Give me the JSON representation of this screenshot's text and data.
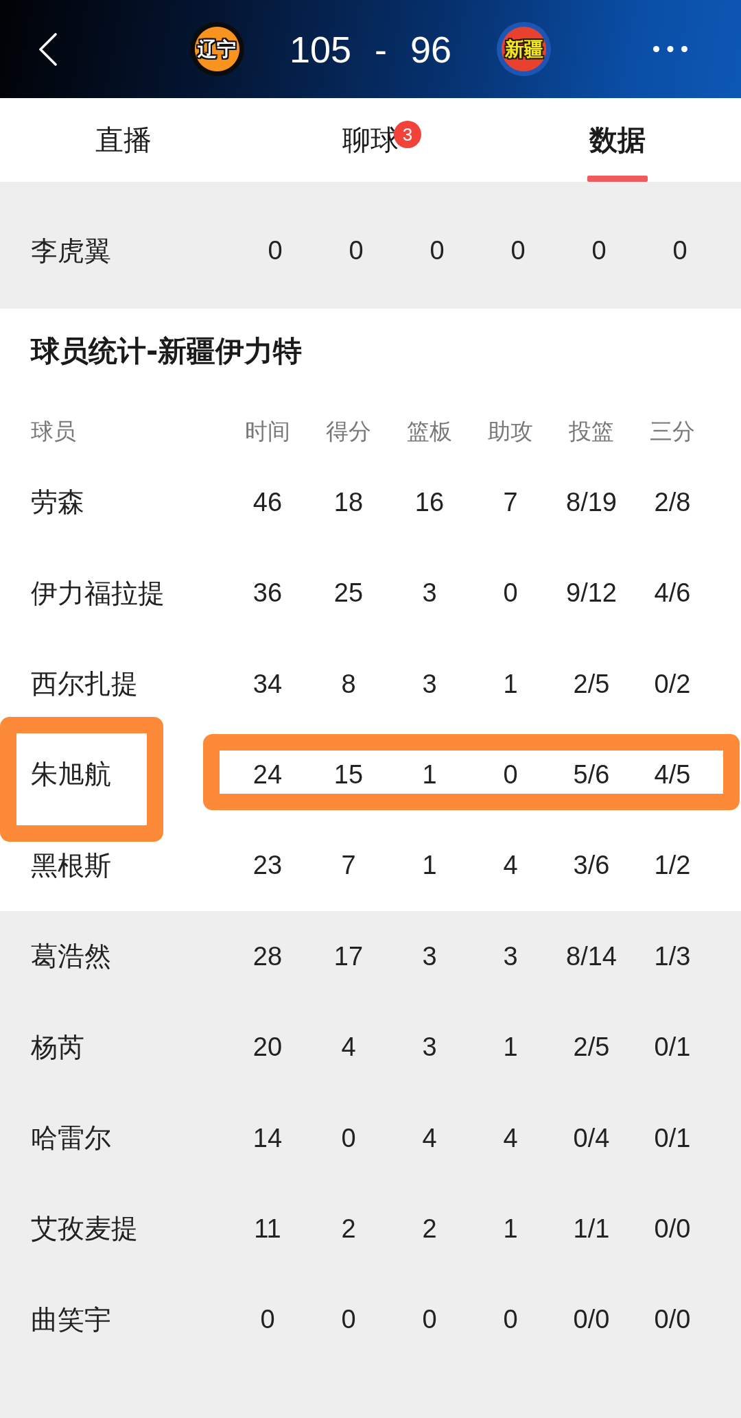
{
  "match": {
    "home": {
      "logo_text": "辽宁",
      "score": "105"
    },
    "separator": "-",
    "away": {
      "logo_text": "新疆",
      "score": "96"
    }
  },
  "tabs": [
    {
      "label": "直播",
      "selected": false
    },
    {
      "label": "聊球",
      "selected": false,
      "badge": "3"
    },
    {
      "label": "数据",
      "selected": true
    }
  ],
  "previous_table": {
    "rows": [
      {
        "name": "李虎翼",
        "values": [
          "0",
          "0",
          "0",
          "0",
          "0",
          "0"
        ],
        "shaded": true
      }
    ]
  },
  "team_stats": {
    "title": "球员统计-新疆伊力特",
    "columns": [
      "球员",
      "时间",
      "得分",
      "篮板",
      "助攻",
      "投篮",
      "三分"
    ],
    "rows": [
      {
        "name": "劳森",
        "values": [
          "46",
          "18",
          "16",
          "7",
          "8/19",
          "2/8"
        ],
        "shaded": false,
        "highlighted": false
      },
      {
        "name": "伊力福拉提",
        "values": [
          "36",
          "25",
          "3",
          "0",
          "9/12",
          "4/6"
        ],
        "shaded": false,
        "highlighted": false
      },
      {
        "name": "西尔扎提",
        "values": [
          "34",
          "8",
          "3",
          "1",
          "2/5",
          "0/2"
        ],
        "shaded": false,
        "highlighted": false
      },
      {
        "name": "朱旭航",
        "values": [
          "24",
          "15",
          "1",
          "0",
          "5/6",
          "4/5"
        ],
        "shaded": false,
        "highlighted": true
      },
      {
        "name": "黑根斯",
        "values": [
          "23",
          "7",
          "1",
          "4",
          "3/6",
          "1/2"
        ],
        "shaded": false,
        "highlighted": false
      },
      {
        "name": "葛浩然",
        "values": [
          "28",
          "17",
          "3",
          "3",
          "8/14",
          "1/3"
        ],
        "shaded": true,
        "highlighted": false
      },
      {
        "name": "杨芮",
        "values": [
          "20",
          "4",
          "3",
          "1",
          "2/5",
          "0/1"
        ],
        "shaded": true,
        "highlighted": false
      },
      {
        "name": "哈雷尔",
        "values": [
          "14",
          "0",
          "4",
          "4",
          "0/4",
          "0/1"
        ],
        "shaded": true,
        "highlighted": false
      },
      {
        "name": "艾孜麦提",
        "values": [
          "11",
          "2",
          "2",
          "1",
          "1/1",
          "0/0"
        ],
        "shaded": true,
        "highlighted": false
      },
      {
        "name": "曲笑宇",
        "values": [
          "0",
          "0",
          "0",
          "0",
          "0/0",
          "0/0"
        ],
        "shaded": true,
        "highlighted": false
      }
    ]
  }
}
